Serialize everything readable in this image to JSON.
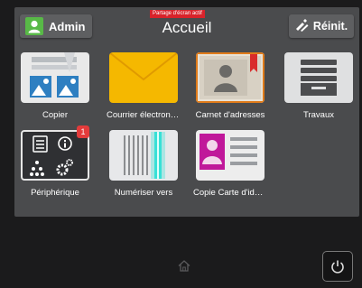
{
  "header": {
    "admin_label": "Admin",
    "title": "Accueil",
    "reset_label": "Réinit.",
    "screen_share_label": "Partage d'écran actif"
  },
  "tiles": [
    {
      "label": "Copier",
      "icon": "copy-icon"
    },
    {
      "label": "Courrier électronique",
      "icon": "email-icon"
    },
    {
      "label": "Carnet d'adresses",
      "icon": "address-book-icon"
    },
    {
      "label": "Travaux",
      "icon": "jobs-icon"
    },
    {
      "label": "Périphérique",
      "icon": "device-icon",
      "badge": "1"
    },
    {
      "label": "Numériser vers",
      "icon": "scan-icon"
    },
    {
      "label": "Copie Carte d'identité",
      "icon": "id-card-copy-icon"
    }
  ],
  "colors": {
    "accent_green": "#58b947",
    "badge_red": "#e33b3b",
    "email_yellow": "#f5b800",
    "id_magenta": "#c0189a"
  }
}
